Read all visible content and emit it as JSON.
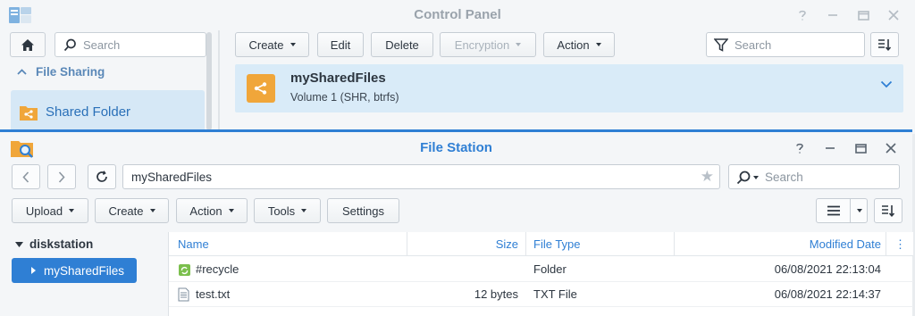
{
  "control_panel": {
    "title": "Control Panel",
    "search_placeholder": "Search",
    "section": "File Sharing",
    "selected_item": "Shared Folder",
    "toolbar": {
      "create": "Create",
      "edit": "Edit",
      "delete": "Delete",
      "encryption": "Encryption",
      "action": "Action"
    },
    "filter_placeholder": "Search",
    "folder": {
      "name": "mySharedFiles",
      "volume": "Volume 1 (SHR, btrfs)"
    }
  },
  "file_station": {
    "title": "File Station",
    "path": "mySharedFiles",
    "search_placeholder": "Search",
    "toolbar": {
      "upload": "Upload",
      "create": "Create",
      "action": "Action",
      "tools": "Tools",
      "settings": "Settings"
    },
    "tree": {
      "root": "diskstation",
      "selected": "mySharedFiles"
    },
    "columns": {
      "name": "Name",
      "size": "Size",
      "file_type": "File Type",
      "modified_date": "Modified Date"
    },
    "rows": [
      {
        "name": "#recycle",
        "size": "",
        "type": "Folder",
        "modified": "06/08/2021 22:13:04",
        "icon": "recycle-folder-icon"
      },
      {
        "name": "test.txt",
        "size": "12 bytes",
        "type": "TXT File",
        "modified": "06/08/2021 22:14:37",
        "icon": "text-file-icon"
      }
    ]
  },
  "colors": {
    "accent": "#2f7fd4",
    "selected_bg": "#d6e8f6",
    "folder_orange": "#f0a63a"
  }
}
